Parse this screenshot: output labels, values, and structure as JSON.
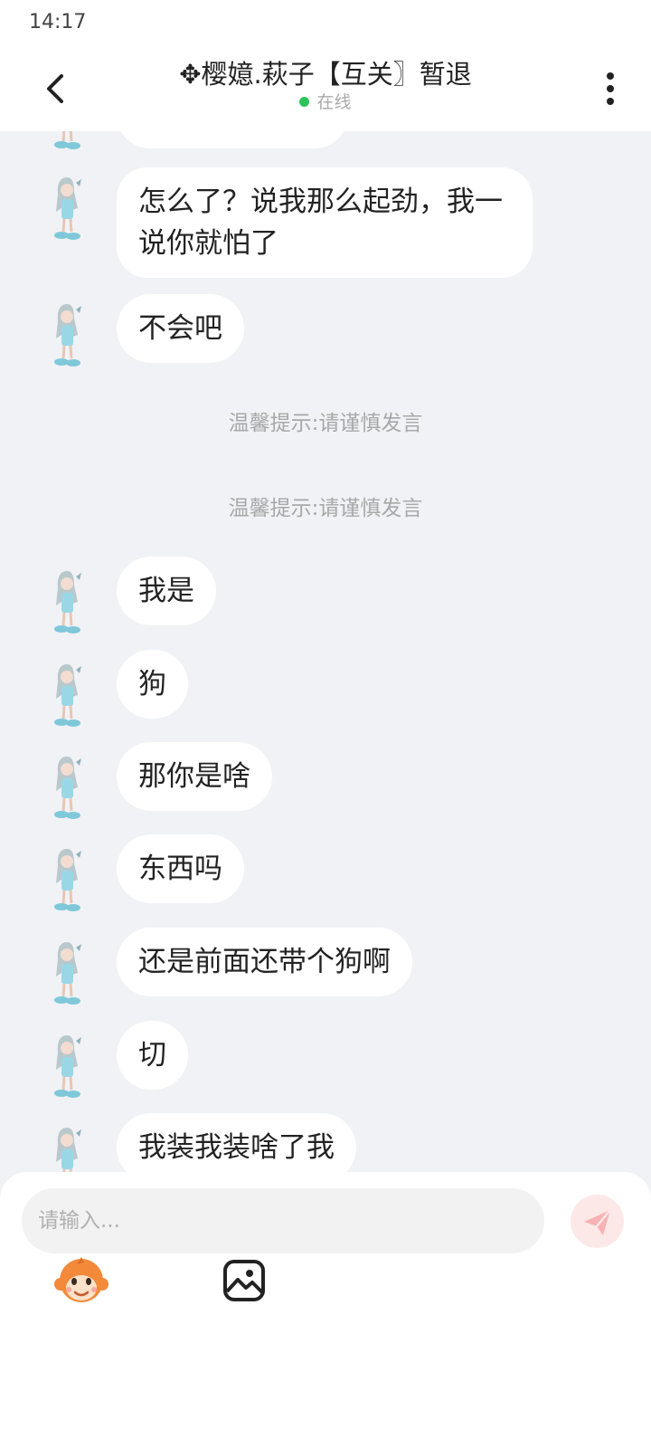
{
  "status_bar": {
    "time": "14:17"
  },
  "header": {
    "title": "✥樱嬑.萩子【互关〗暂退",
    "status": "在线"
  },
  "messages": [
    {
      "type": "text",
      "text": ""
    },
    {
      "type": "text",
      "text": "怎么了？说我那么起劲，我一说你就怕了"
    },
    {
      "type": "text",
      "text": "不会吧"
    },
    {
      "type": "notice",
      "text": "温馨提示:请谨慎发言"
    },
    {
      "type": "notice",
      "text": "温馨提示:请谨慎发言"
    },
    {
      "type": "text",
      "text": "我是"
    },
    {
      "type": "text",
      "text": "狗"
    },
    {
      "type": "text",
      "text": "那你是啥"
    },
    {
      "type": "text",
      "text": "东西吗"
    },
    {
      "type": "text",
      "text": "还是前面还带个狗啊"
    },
    {
      "type": "text",
      "text": "切"
    },
    {
      "type": "text",
      "text": "我装我装啥了我"
    }
  ],
  "composer": {
    "placeholder": "请输入...",
    "value": ""
  },
  "icons": {
    "back": "chevron-left-icon",
    "more": "more-vertical-icon",
    "send": "send-icon",
    "emoji": "monkey-emoji-icon",
    "image": "image-icon"
  },
  "colors": {
    "background": "#f0f2f5",
    "bubble": "#ffffff",
    "online": "#2dc25a",
    "send_button": "#fde8e8",
    "send_icon": "#f7b3b3"
  }
}
